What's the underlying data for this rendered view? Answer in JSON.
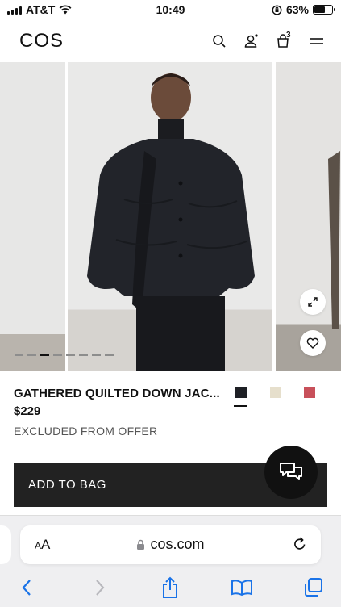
{
  "status_bar": {
    "carrier": "AT&T",
    "time": "10:49",
    "battery": "63%",
    "battery_level": 0.63
  },
  "header": {
    "logo": "COS",
    "icons": [
      "search-icon",
      "account-icon",
      "bag-icon",
      "menu-icon"
    ],
    "bag_count": "3"
  },
  "carousel": {
    "slide_count": 8,
    "active_slide": 3
  },
  "product": {
    "title": "GATHERED QUILTED DOWN JAC...",
    "price": "$229",
    "offer_note": "EXCLUDED FROM OFFER",
    "swatches": [
      {
        "color": "#1e2025",
        "selected": true
      },
      {
        "color": "#e6dfcc",
        "selected": false
      },
      {
        "color": "#c8505a",
        "selected": false
      }
    ]
  },
  "add_to_bag_label": "ADD TO BAG",
  "safari": {
    "text_size_label": "AA",
    "url": "cos.com"
  }
}
